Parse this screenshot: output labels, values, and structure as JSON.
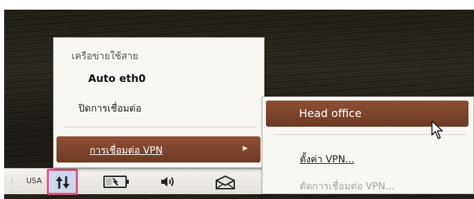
{
  "panel": {
    "handle": "⋮",
    "keyboard_layout": "USA",
    "icons": [
      "network-updown-icon",
      "battery-charging-icon",
      "volume-icon",
      "mail-icon"
    ]
  },
  "network_menu": {
    "section_header": "เครือข่ายใช้สาย",
    "active_connection": "Auto eth0",
    "disconnect_label": "ปิดการเชื่อมต่อ",
    "vpn_submenu_label": "การเชื่อมต่อ VPN",
    "submenu_arrow": "▶"
  },
  "vpn_submenu": {
    "connection": "Head office",
    "configure_label": "ตั้งค่า VPN...",
    "disconnect_label": "ตัดการเชื่อมต่อ VPN..."
  },
  "colors": {
    "highlight": "#7d4530",
    "panel_active": "#cdd6ea",
    "active_border": "#e0577f"
  }
}
